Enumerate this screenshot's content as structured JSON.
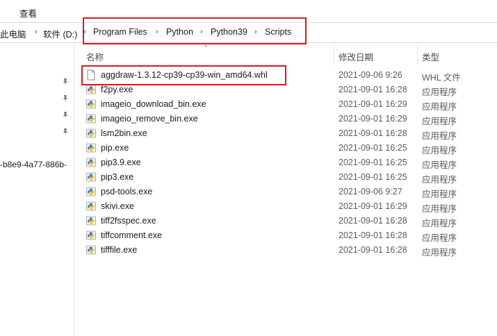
{
  "ribbon": {
    "view_tab": "查看"
  },
  "address": {
    "crumbs": [
      "此电脑",
      "软件 (D:)",
      "Program Files",
      "Python",
      "Python39",
      "Scripts"
    ],
    "highlight_color": "#e0161b"
  },
  "nav": {
    "item_guid": "-b8e9-4a77-886b-"
  },
  "columns": {
    "name": "名称",
    "date": "修改日期",
    "type": "类型"
  },
  "files": [
    {
      "name": "aggdraw-1.3.12-cp39-cp39-win_amd64.whl",
      "date": "2021-09-06 9:26",
      "type": "WHL 文件",
      "icon": "document-icon"
    },
    {
      "name": "f2py.exe",
      "date": "2021-09-01 16:28",
      "type": "应用程序",
      "icon": "python-exe-icon"
    },
    {
      "name": "imageio_download_bin.exe",
      "date": "2021-09-01 16:29",
      "type": "应用程序",
      "icon": "python-exe-icon"
    },
    {
      "name": "imageio_remove_bin.exe",
      "date": "2021-09-01 16:29",
      "type": "应用程序",
      "icon": "python-exe-icon"
    },
    {
      "name": "lsm2bin.exe",
      "date": "2021-09-01 16:28",
      "type": "应用程序",
      "icon": "python-exe-icon"
    },
    {
      "name": "pip.exe",
      "date": "2021-09-01 16:25",
      "type": "应用程序",
      "icon": "python-exe-icon"
    },
    {
      "name": "pip3.9.exe",
      "date": "2021-09-01 16:25",
      "type": "应用程序",
      "icon": "python-exe-icon"
    },
    {
      "name": "pip3.exe",
      "date": "2021-09-01 16:25",
      "type": "应用程序",
      "icon": "python-exe-icon"
    },
    {
      "name": "psd-tools.exe",
      "date": "2021-09-06 9:27",
      "type": "应用程序",
      "icon": "python-exe-icon"
    },
    {
      "name": "skivi.exe",
      "date": "2021-09-01 16:29",
      "type": "应用程序",
      "icon": "python-exe-icon"
    },
    {
      "name": "tiff2fsspec.exe",
      "date": "2021-09-01 16:28",
      "type": "应用程序",
      "icon": "python-exe-icon"
    },
    {
      "name": "tiffcomment.exe",
      "date": "2021-09-01 16:28",
      "type": "应用程序",
      "icon": "python-exe-icon"
    },
    {
      "name": "tifffile.exe",
      "date": "2021-09-01 16:28",
      "type": "应用程序",
      "icon": "python-exe-icon"
    }
  ]
}
